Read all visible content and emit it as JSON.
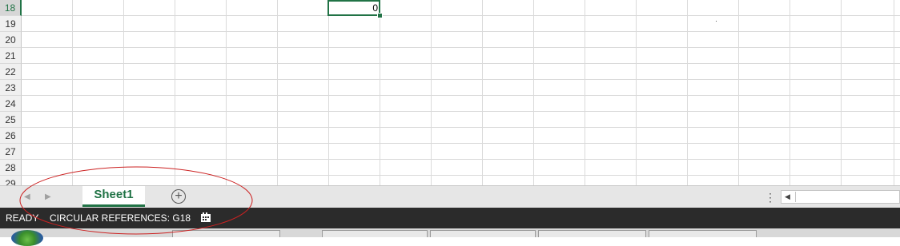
{
  "spreadsheet": {
    "row_headers": [
      "18",
      "19",
      "20",
      "21",
      "22",
      "23",
      "24",
      "25",
      "26",
      "27",
      "28",
      "29"
    ],
    "active_row": "18",
    "active_cell_value": "0"
  },
  "tabs": {
    "sheet_name": "Sheet1",
    "add_sheet_symbol": "+",
    "more_symbol": "⋮"
  },
  "status_bar": {
    "mode": "READY",
    "circular_references": "CIRCULAR REFERENCES: G18"
  },
  "colors": {
    "accent": "#217346",
    "status_bg": "#2b2b2b",
    "annotation": "#cc2222"
  }
}
